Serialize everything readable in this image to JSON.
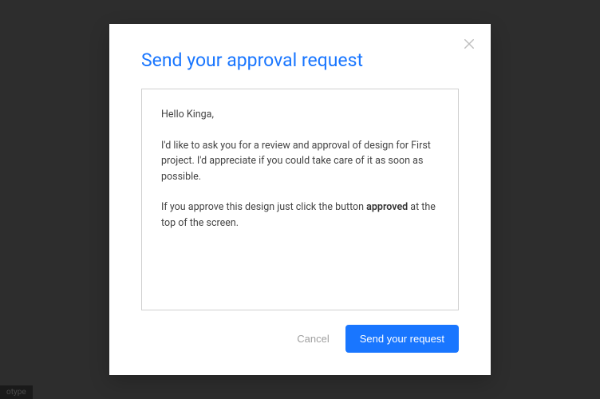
{
  "modal": {
    "title": "Send your approval request",
    "message": {
      "greeting": "Hello Kinga,",
      "body1": "I'd like to ask you for a review and approval of design for First project. I'd appreciate if you could take care of it as soon as possible.",
      "body2_before": "If you approve this design just click the button ",
      "body2_bold": "approved",
      "body2_after": " at the top of the screen."
    },
    "actions": {
      "cancel_label": "Cancel",
      "send_label": "Send your request"
    }
  },
  "corner_tag": "otype"
}
